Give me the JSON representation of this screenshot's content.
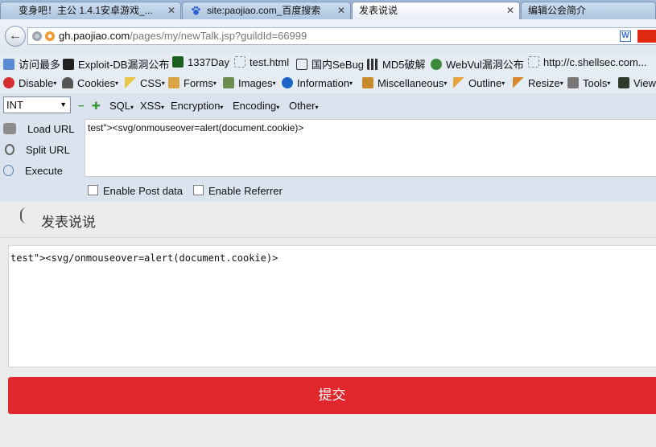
{
  "tabs": [
    {
      "label": "变身吧！主公 1.4.1安卓游戏_..."
    },
    {
      "label": "site:paojiao.com_百度搜索"
    },
    {
      "label": "发表说说"
    },
    {
      "label": "编辑公会简介"
    }
  ],
  "tab_close": "✕",
  "address": {
    "host": "gh.paojiao.com",
    "path": "/pages/my/newTalk.jsp?guildId=66999"
  },
  "bookmarks": [
    {
      "label": "访问最多",
      "icon": "globe-icon"
    },
    {
      "label": "Exploit-DB漏洞公布",
      "icon": "exploitdb-icon"
    },
    {
      "label": "1337Day",
      "icon": "1337day-icon"
    },
    {
      "label": "test.html",
      "icon": "page-icon"
    },
    {
      "label": "国内SeBug",
      "icon": "sebug-icon"
    },
    {
      "label": "MD5破解",
      "icon": "grid-icon"
    },
    {
      "label": "WebVul漏洞公布",
      "icon": "bug-icon"
    },
    {
      "label": "http://c.shellsec.com...",
      "icon": "page-icon"
    }
  ],
  "webdev_menu": [
    "Disable",
    "Cookies",
    "CSS",
    "Forms",
    "Images",
    "Information",
    "Miscellaneous",
    "Outline",
    "Resize",
    "Tools",
    "View"
  ],
  "hackbar": {
    "select_value": "INT",
    "menus": [
      "SQL",
      "XSS",
      "Encryption",
      "Encoding",
      "Other"
    ],
    "load_url": "Load URL",
    "split_url": "Split URL",
    "execute": "Execute",
    "url_text": "test\"><svg/onmouseover=alert(document.cookie)>",
    "enable_post": "Enable Post data",
    "enable_referrer": "Enable Referrer"
  },
  "page": {
    "title": "发表说说",
    "talk_text": "test\"><svg/onmouseover=alert(document.cookie)>",
    "submit_label": "提交"
  },
  "colors": {
    "submit": "#e0282c",
    "tabbar": "#9fb9d6"
  }
}
